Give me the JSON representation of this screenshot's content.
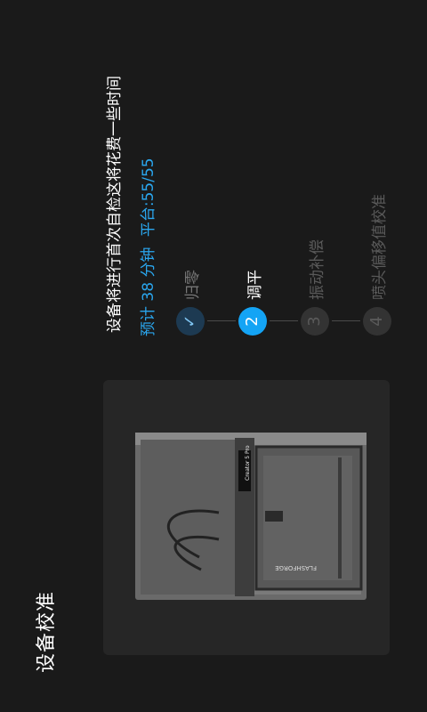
{
  "page_title": "设备校准",
  "message": "设备将进行首次自检这将花费一些时间",
  "estimate": {
    "time_label": "预计 38 分钟",
    "platform_label": "平台:55/55"
  },
  "steps": [
    {
      "number": "1",
      "label": "归零",
      "state": "done",
      "icon": "check-icon"
    },
    {
      "number": "2",
      "label": "调平",
      "state": "active"
    },
    {
      "number": "3",
      "label": "振动补偿",
      "state": "todo"
    },
    {
      "number": "4",
      "label": "喷头偏移值校准",
      "state": "todo"
    }
  ],
  "printer_image": {
    "brand": "FLASHFORGE",
    "model": "Creator 5 Pro"
  },
  "colors": {
    "background": "#1a1a1a",
    "accent": "#14a4f5",
    "estimate_text": "#2aa6ee"
  }
}
